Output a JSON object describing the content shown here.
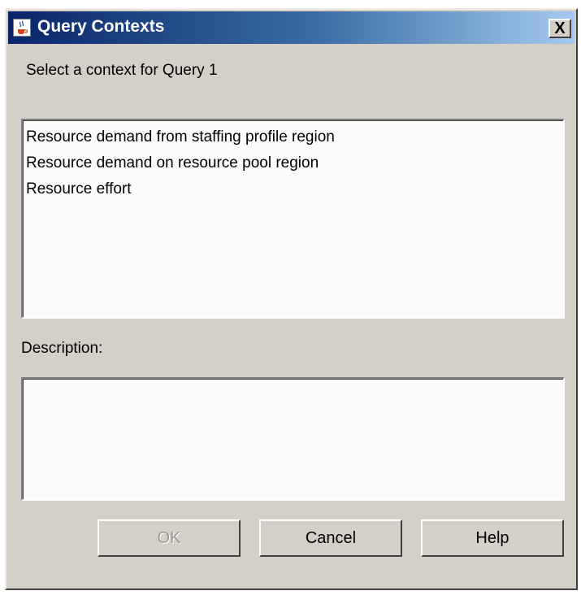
{
  "window": {
    "title": "Query Contexts",
    "close_label": "X",
    "icon": "java-cup-icon"
  },
  "prompt": "Select a context for Query 1",
  "contexts": [
    "Resource demand from staffing profile region",
    "Resource demand on resource pool region",
    "Resource effort"
  ],
  "description": {
    "label": "Description:",
    "value": ""
  },
  "buttons": {
    "ok": "OK",
    "cancel": "Cancel",
    "help": "Help"
  },
  "states": {
    "ok_enabled": false
  },
  "colors": {
    "title_gradient_start": "#0a246a",
    "title_gradient_end": "#a6caf0",
    "dialog_bg": "#d4d0c8",
    "field_bg": "#fbfcf9",
    "disabled_text": "#9a9892"
  }
}
